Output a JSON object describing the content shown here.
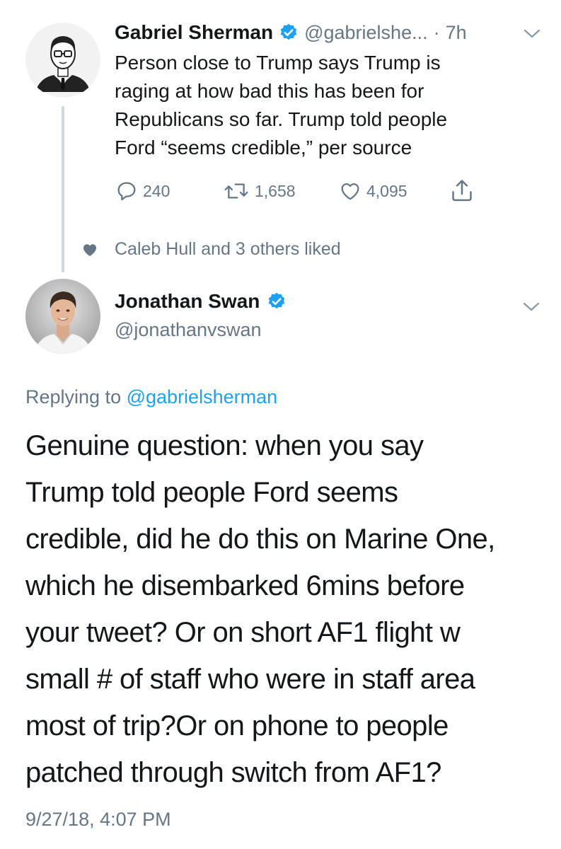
{
  "tweet1": {
    "author_name": "Gabriel Sherman",
    "handle": "@gabrielshe...",
    "separator": "·",
    "time": "7h",
    "lines": [
      "Person close to Trump says Trump is",
      "raging at how bad this has been for",
      "Republicans so far. Trump told people",
      "Ford “seems credible,” per source"
    ],
    "replies": "240",
    "retweets": "1,658",
    "likes": "4,095",
    "icons": [
      "verified-badge-icon",
      "chevron-down-icon",
      "reply-icon",
      "retweet-icon",
      "heart-icon",
      "share-icon"
    ]
  },
  "social_context": {
    "text": "Caleb Hull and 3 others liked",
    "icon": "heart-filled-icon"
  },
  "tweet2": {
    "author_name": "Jonathan Swan",
    "handle": "@jonathanvswan",
    "replying_prefix": "Replying to",
    "replying_handle": "@gabrielsherman",
    "lines": [
      "Genuine question: when you say",
      "Trump told people Ford seems",
      "credible, did he do this on Marine One,",
      "which he disembarked 6mins before",
      "your tweet? Or on short AF1 flight w",
      "small # of staff who were in staff area",
      "most of trip?Or on phone to people",
      "patched through switch from AF1?"
    ],
    "timestamp": "9/27/18, 4:07 PM"
  },
  "colors": {
    "text": "#14171a",
    "secondary": "#657786",
    "link": "#1da1f2",
    "verified": "#1da1f2",
    "thread_line": "#ccd6dd"
  }
}
